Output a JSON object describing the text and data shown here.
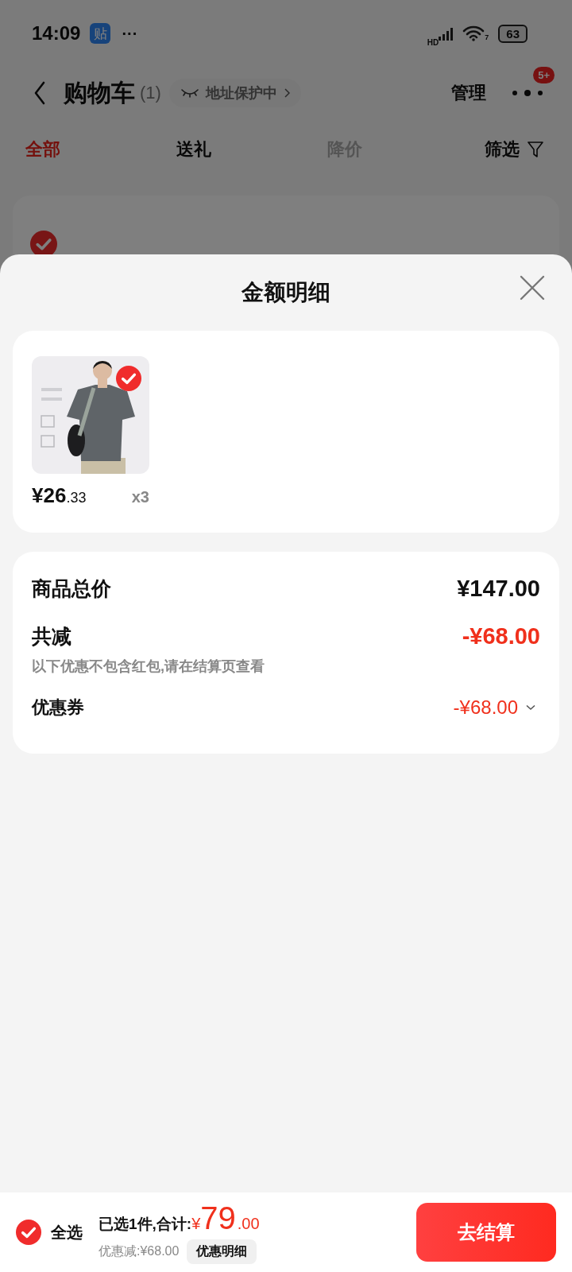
{
  "status_bar": {
    "time": "14:09",
    "app_badge": "贴",
    "more": "···",
    "network": "HD",
    "wifi_label": "7",
    "battery": "63"
  },
  "header": {
    "title": "购物车",
    "count": "(1)",
    "address_chip": "地址保护中",
    "manage": "管理",
    "more_badge": "5+"
  },
  "tabs": [
    {
      "label": "全部",
      "selected": true,
      "disabled": false
    },
    {
      "label": "送礼",
      "selected": false,
      "disabled": false
    },
    {
      "label": "降价",
      "selected": false,
      "disabled": true
    }
  ],
  "filter": "筛选",
  "shop": {
    "checked": true
  },
  "sheet": {
    "title": "金额明细"
  },
  "items": [
    {
      "kind": "picture",
      "price_int": "¥26",
      "price_dec": ".33",
      "quantity": "x3",
      "checked": true
    }
  ],
  "summary": [
    {
      "kind": "total",
      "label": "商品总价",
      "value": "¥147.00"
    },
    {
      "kind": "discount",
      "label": "共减",
      "value": "-¥68.00",
      "note": "以下优惠不包含红包,请在结算页查看"
    },
    {
      "kind": "coupon",
      "label": "优惠券",
      "value": "-¥68.00",
      "expandable": true
    }
  ],
  "footer": {
    "select_all": {
      "label": "全选",
      "checked": true
    },
    "selected_text": "已选1件,合计:",
    "currency": "¥",
    "amount_int": "79",
    "amount_dec": ".00",
    "discount": "优惠减:¥68.00",
    "detail_button": "优惠明细",
    "checkout": "去结算"
  }
}
